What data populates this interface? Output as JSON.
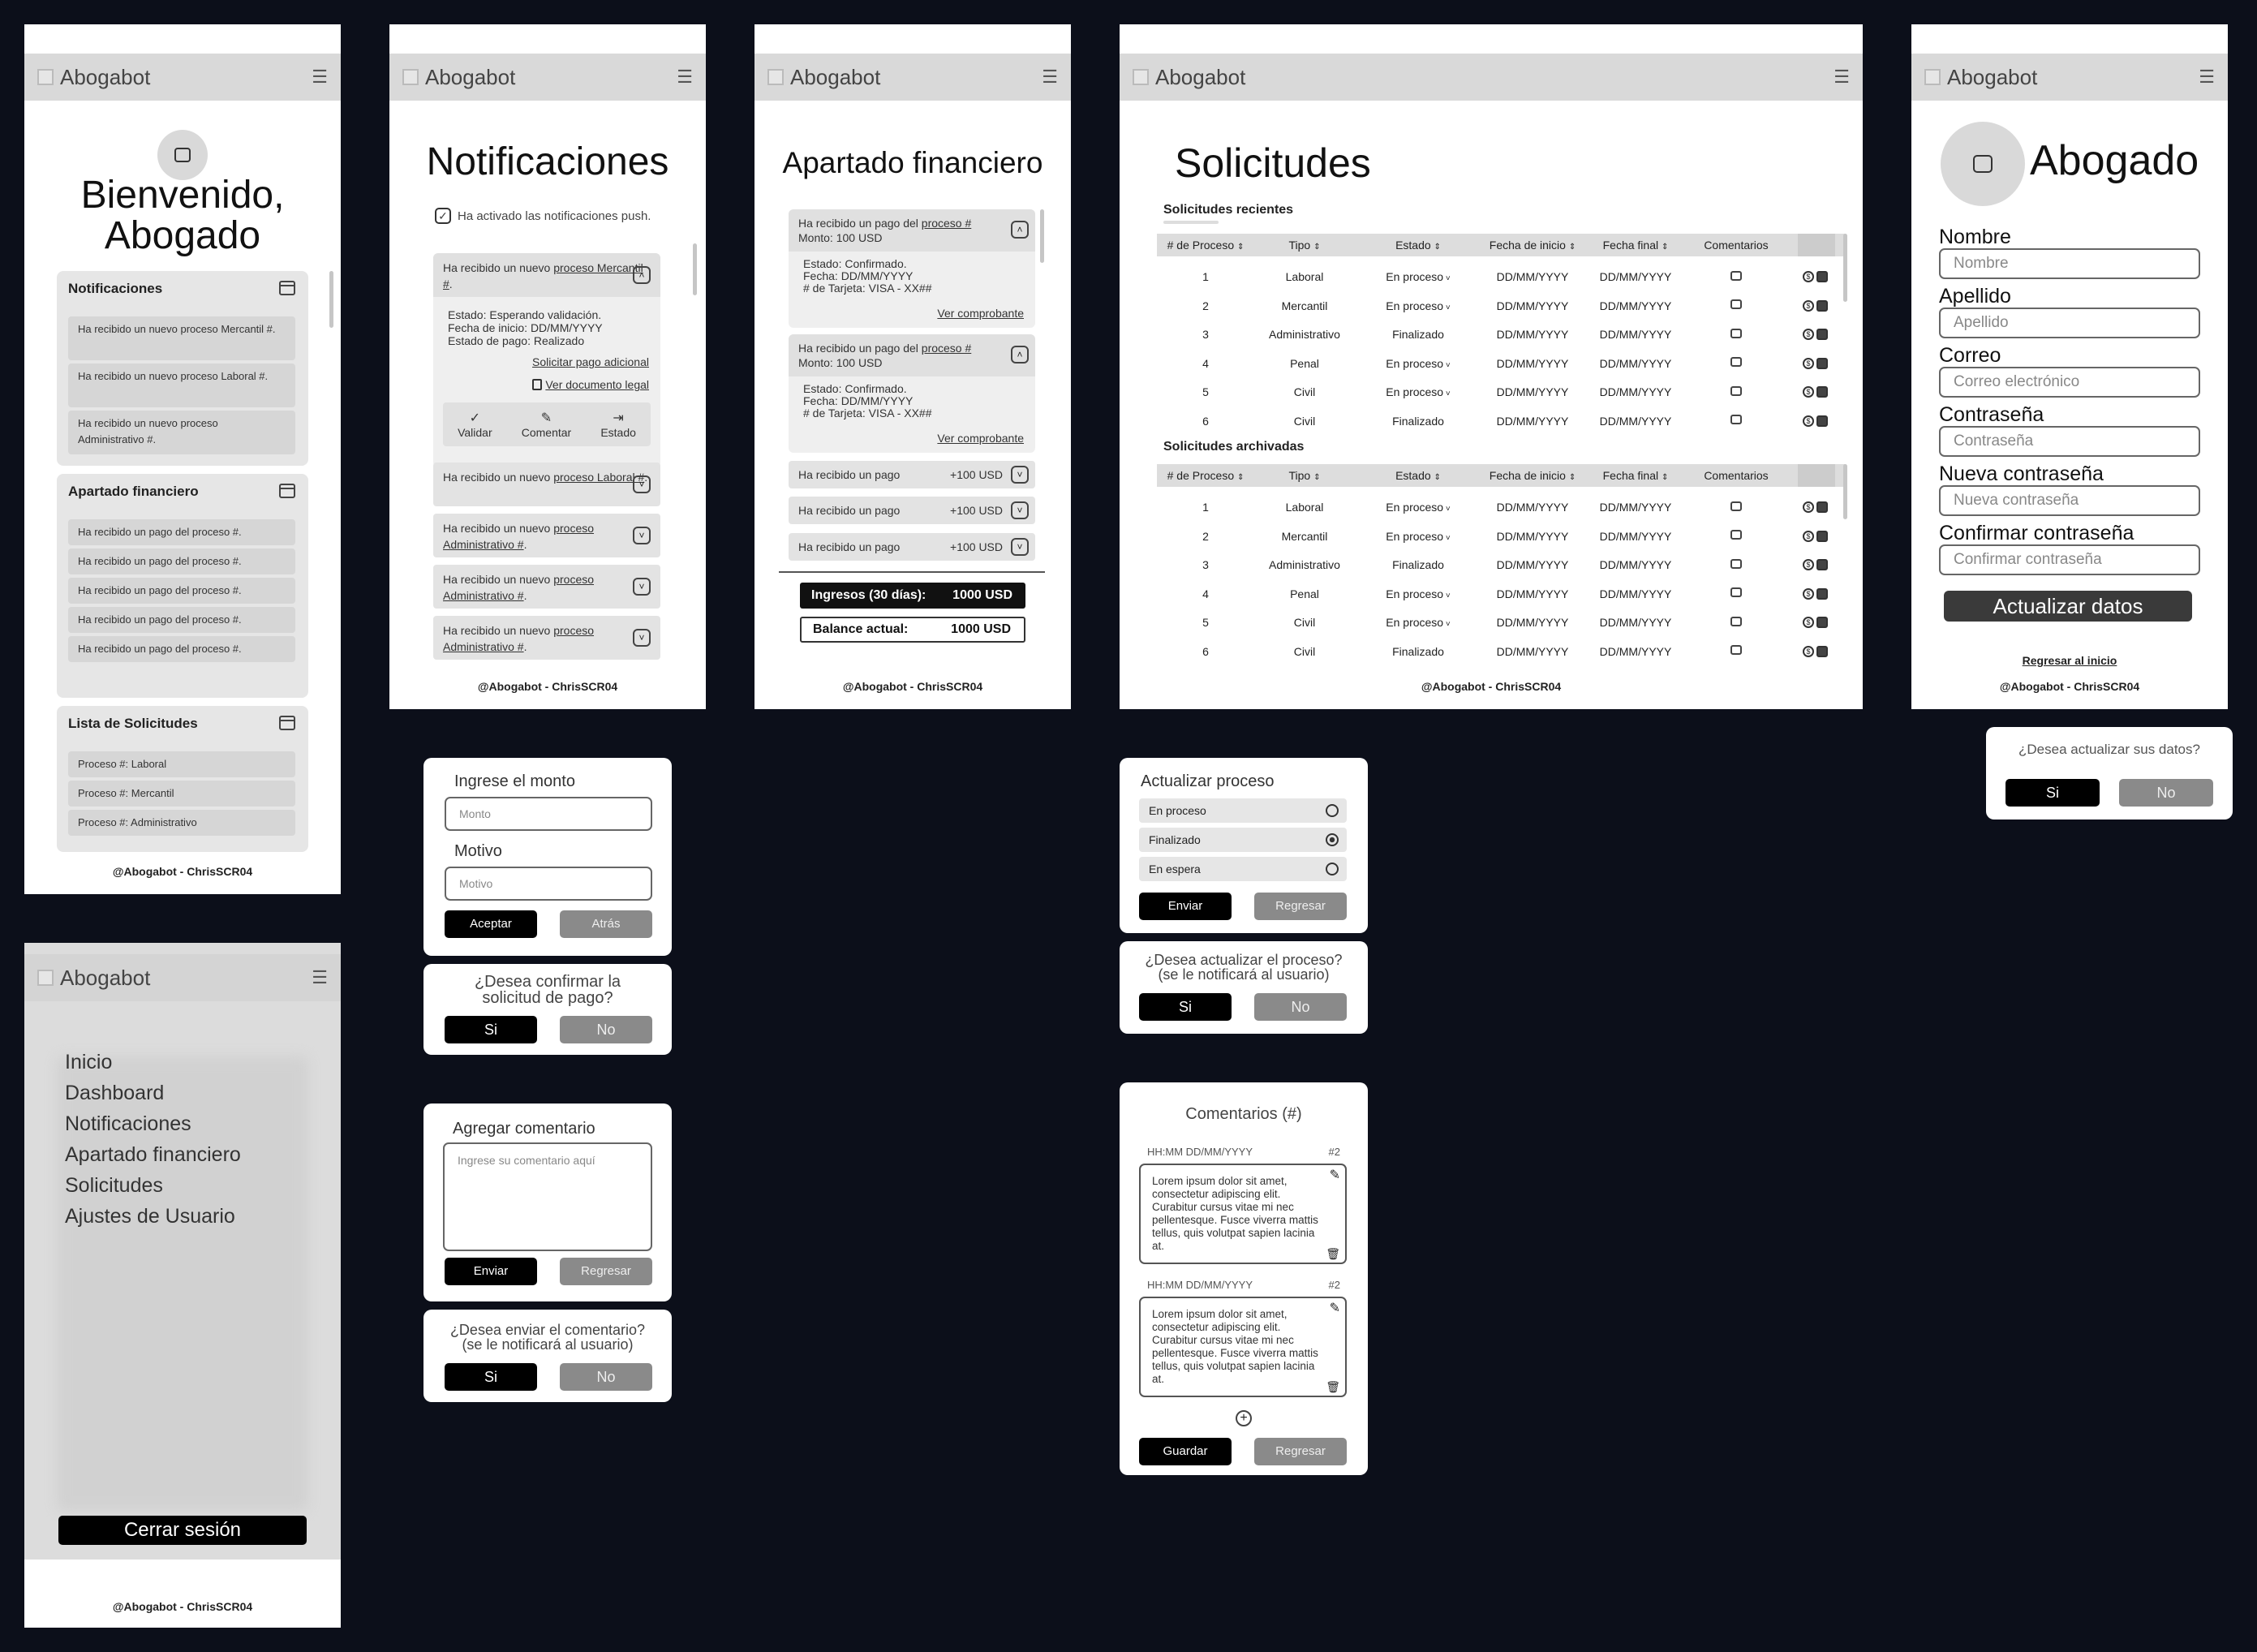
{
  "brand": "Abogabot",
  "footer": "@Abogabot -  ChrisSCR04",
  "dashboard": {
    "title_line1": "Bienvenido,",
    "title_line2": "Abogado",
    "notif_title": "Notificaciones",
    "notif_items": [
      "Ha recibido un nuevo proceso Mercantil #.",
      "Ha recibido un nuevo proceso Laboral #.",
      "Ha recibido un nuevo proceso Administrativo #."
    ],
    "fin_title": "Apartado financiero",
    "fin_items": [
      "Ha recibido un pago del proceso #.",
      "Ha recibido un pago del proceso #.",
      "Ha recibido un pago del proceso #.",
      "Ha recibido un pago del proceso #.",
      "Ha recibido un pago del proceso #."
    ],
    "sol_title": "Lista de Solicitudes",
    "sol_items": [
      "Proceso #: Laboral",
      "Proceso #: Mercantil",
      "Proceso #: Administrativo"
    ]
  },
  "menu": {
    "items": [
      "Inicio",
      "Dashboard",
      "Notificaciones",
      "Apartado financiero",
      "Solicitudes",
      "Ajustes de Usuario"
    ],
    "logout": "Cerrar sesión"
  },
  "notifications": {
    "title": "Notificaciones",
    "push": "Ha activado las notificaciones push.",
    "first_prefix": "Ha recibido un nuevo ",
    "first_link": "proceso Mercantil #",
    "detail1": "Estado: Esperando validación.",
    "detail2": "Fecha de inicio: DD/MM/YYYY",
    "detail3": "Estado de pago: Realizado",
    "link_pago": "Solicitar pago adicional",
    "link_doc": "Ver documento legal",
    "act_validar": "Validar",
    "act_comentar": "Comentar",
    "act_estado": "Estado",
    "others": [
      {
        "prefix": "Ha recibido un nuevo ",
        "link": "proceso Laboral #"
      },
      {
        "prefix": "Ha recibido un nuevo ",
        "link": "proceso Administrativo #"
      },
      {
        "prefix": "Ha recibido un nuevo ",
        "link": "proceso Administrativo #"
      },
      {
        "prefix": "Ha recibido un nuevo ",
        "link": "proceso Administrativo #"
      }
    ]
  },
  "payment_modal": {
    "amount_label": "Ingrese el monto",
    "amount_ph": "Monto",
    "reason_label": "Motivo",
    "reason_ph": "Motivo",
    "accept": "Aceptar",
    "back": "Atrás"
  },
  "confirm_payment": {
    "text1": "¿Desea confirmar la",
    "text2": "solicitud de pago?",
    "yes": "Si",
    "no": "No"
  },
  "comment_modal": {
    "label": "Agregar comentario",
    "ph": "Ingrese su comentario aquí",
    "send": "Enviar",
    "back": "Regresar"
  },
  "confirm_comment": {
    "text1": "¿Desea enviar el comentario?",
    "text2": "(se le notificará al usuario)",
    "yes": "Si",
    "no": "No"
  },
  "finance": {
    "title": "Apartado financiero",
    "pay1_prefix": "Ha recibido un pago del ",
    "pay1_link": "proceso #",
    "pay1_amount": "Monto: 100 USD",
    "d1": "Estado: Confirmado.",
    "d2": "Fecha: DD/MM/YYYY",
    "d3": "# de Tarjeta: VISA - XX##",
    "receipt": "Ver comprobante",
    "collapsed": [
      {
        "text": "Ha recibido un pago",
        "amt": "+100 USD"
      },
      {
        "text": "Ha recibido un pago",
        "amt": "+100 USD"
      },
      {
        "text": "Ha recibido un pago",
        "amt": "+100 USD"
      }
    ],
    "income_label": "Ingresos (30 días):",
    "income_val": "1000 USD",
    "balance_label": "Balance actual:",
    "balance_val": "1000 USD"
  },
  "requests": {
    "title": "Solicitudes",
    "recent": "Solicitudes recientes",
    "archived": "Solicitudes archivadas",
    "headers": [
      "# de Proceso",
      "Tipo",
      "Estado",
      "Fecha de inicio",
      "Fecha final",
      "Comentarios"
    ],
    "rows": [
      [
        "1",
        "Laboral",
        "En proceso",
        "DD/MM/YYYY",
        "DD/MM/YYYY"
      ],
      [
        "2",
        "Mercantil",
        "En proceso",
        "DD/MM/YYYY",
        "DD/MM/YYYY"
      ],
      [
        "3",
        "Administrativo",
        "Finalizado",
        "DD/MM/YYYY",
        "DD/MM/YYYY"
      ],
      [
        "4",
        "Penal",
        "En proceso",
        "DD/MM/YYYY",
        "DD/MM/YYYY"
      ],
      [
        "5",
        "Civil",
        "En proceso",
        "DD/MM/YYYY",
        "DD/MM/YYYY"
      ],
      [
        "6",
        "Civil",
        "Finalizado",
        "DD/MM/YYYY",
        "DD/MM/YYYY"
      ]
    ]
  },
  "update_process": {
    "title": "Actualizar proceso",
    "options": [
      "En proceso",
      "Finalizado",
      "En espera"
    ],
    "selected": "Finalizado",
    "send": "Enviar",
    "back": "Regresar"
  },
  "confirm_process": {
    "text1": "¿Desea actualizar el proceso?",
    "text2": "(se le notificará al usuario)",
    "yes": "Si",
    "no": "No"
  },
  "comments": {
    "title": "Comentarios (#)",
    "entries": [
      {
        "time": "HH:MM DD/MM/YYYY",
        "num": "#2",
        "text": "Lorem ipsum dolor sit amet, consectetur adipiscing elit. Curabitur cursus vitae mi nec pellentesque. Fusce viverra mattis tellus, quis volutpat sapien lacinia at."
      },
      {
        "time": "HH:MM DD/MM/YYYY",
        "num": "#2",
        "text": "Lorem ipsum dolor sit amet, consectetur adipiscing elit. Curabitur cursus vitae mi nec pellentesque. Fusce viverra mattis tellus, quis volutpat sapien lacinia at."
      }
    ],
    "save": "Guardar",
    "back": "Regresar"
  },
  "profile": {
    "title": "Abogado",
    "fields": [
      {
        "label": "Nombre",
        "ph": "Nombre"
      },
      {
        "label": "Apellido",
        "ph": "Apellido"
      },
      {
        "label": "Correo",
        "ph": "Correo electrónico"
      },
      {
        "label": "Contraseña",
        "ph": "Contraseña"
      },
      {
        "label": "Nueva contraseña",
        "ph": "Nueva contraseña"
      },
      {
        "label": "Confirmar contraseña",
        "ph": "Confirmar contraseña"
      }
    ],
    "update": "Actualizar datos",
    "home_link": "Regresar al inicio"
  },
  "confirm_profile": {
    "text": "¿Desea actualizar sus datos?",
    "yes": "Si",
    "no": "No"
  }
}
